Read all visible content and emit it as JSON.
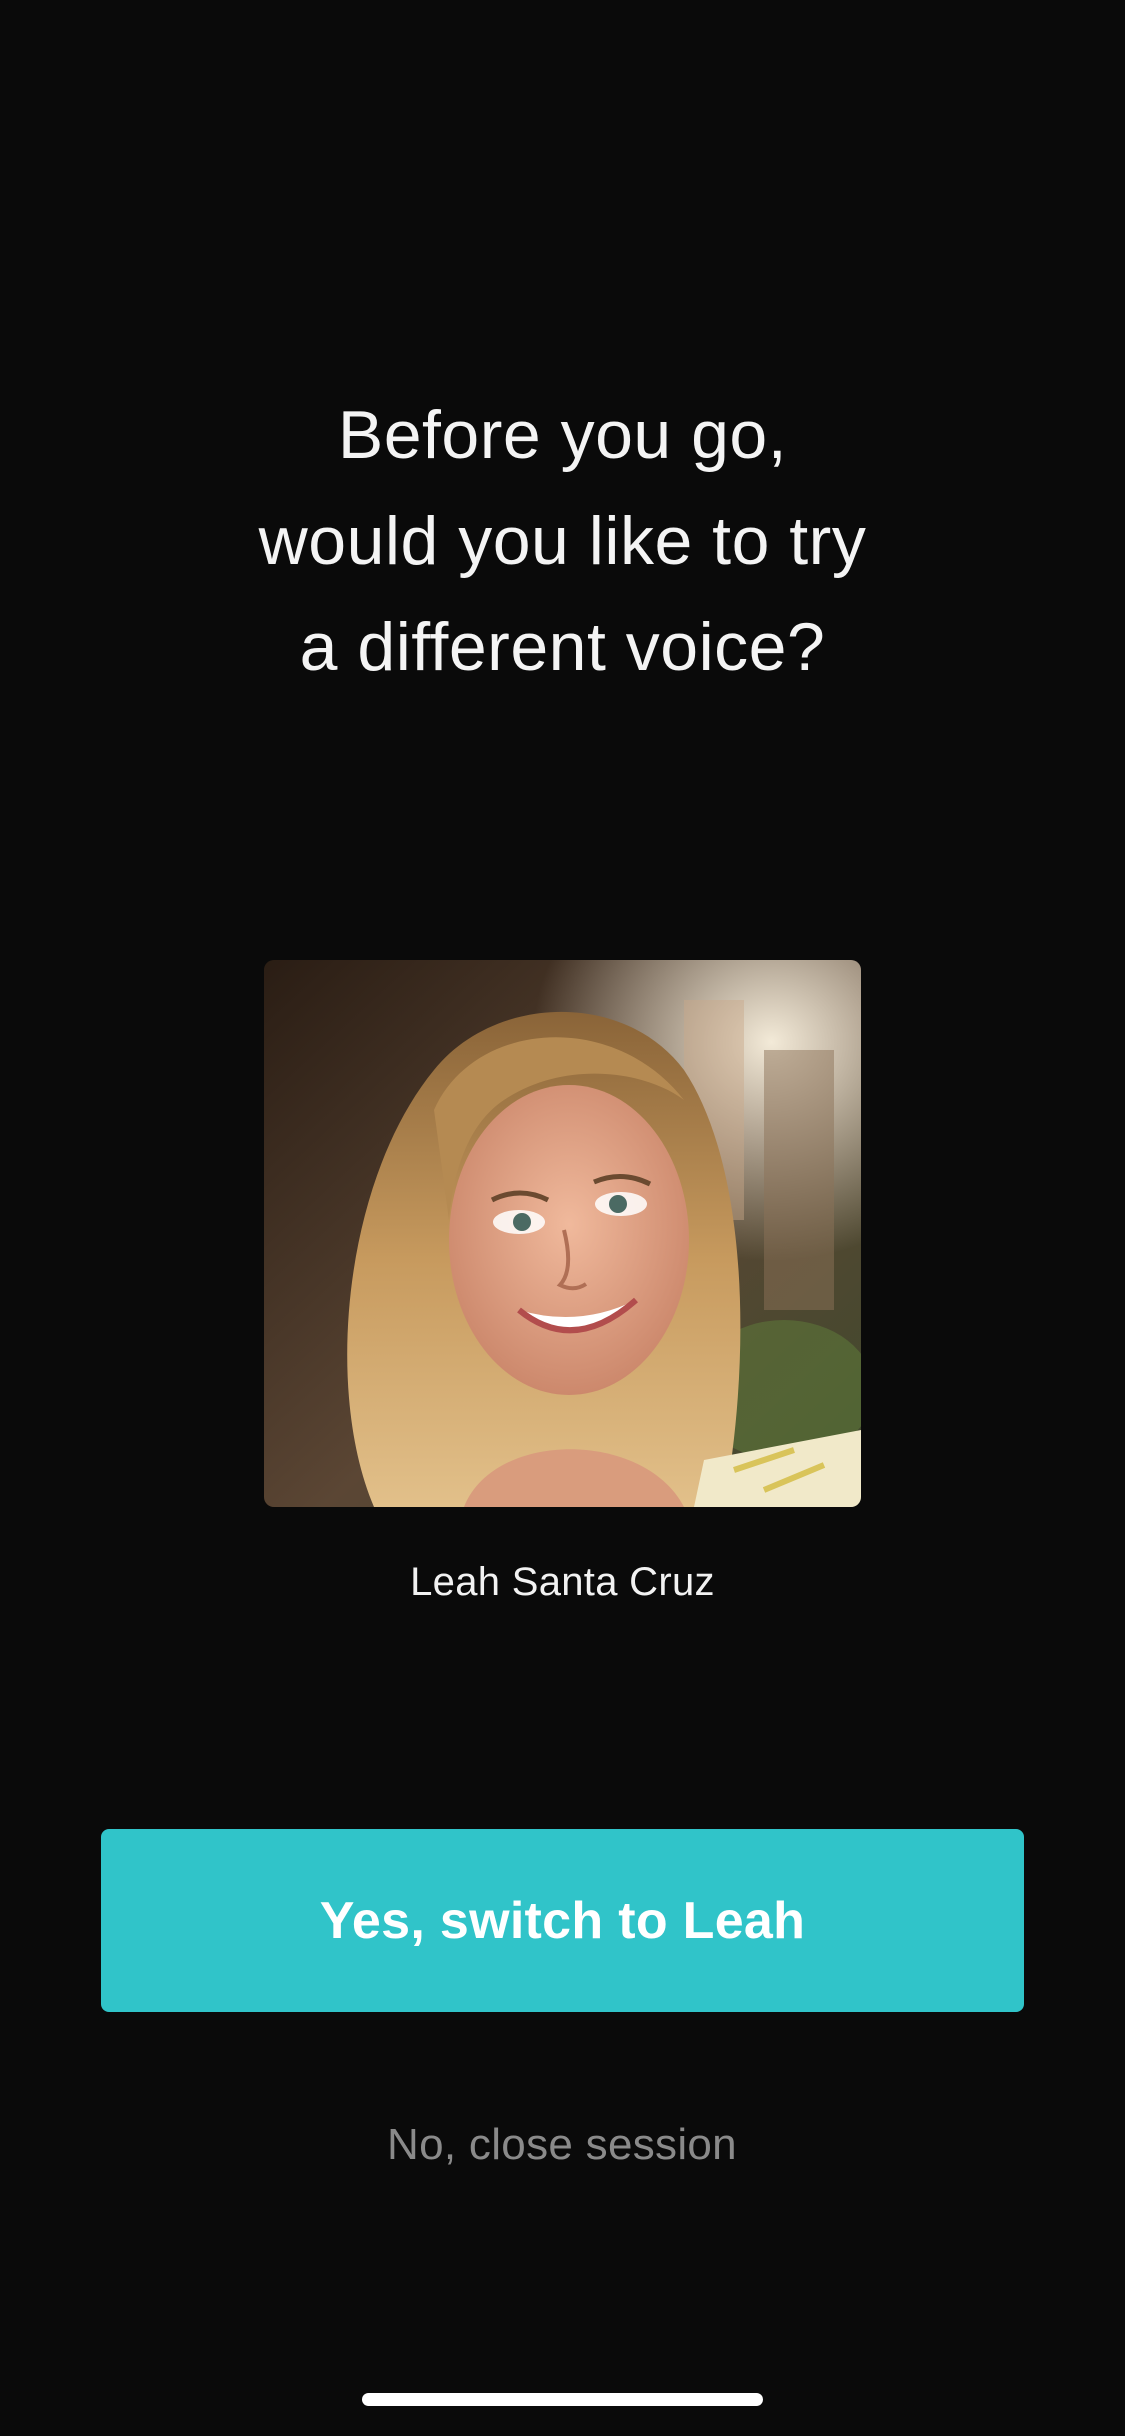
{
  "prompt": {
    "lines": [
      "Before you go,",
      "would you like to try",
      "a different voice?"
    ]
  },
  "voice": {
    "name": "Leah Santa Cruz",
    "photo_icon": "portrait-photo"
  },
  "actions": {
    "confirm_label": "Yes, switch to Leah",
    "decline_label": "No, close session"
  },
  "colors": {
    "background": "#0a0a0a",
    "accent": "#30c4c9",
    "secondary_text": "#8a8a8a"
  }
}
